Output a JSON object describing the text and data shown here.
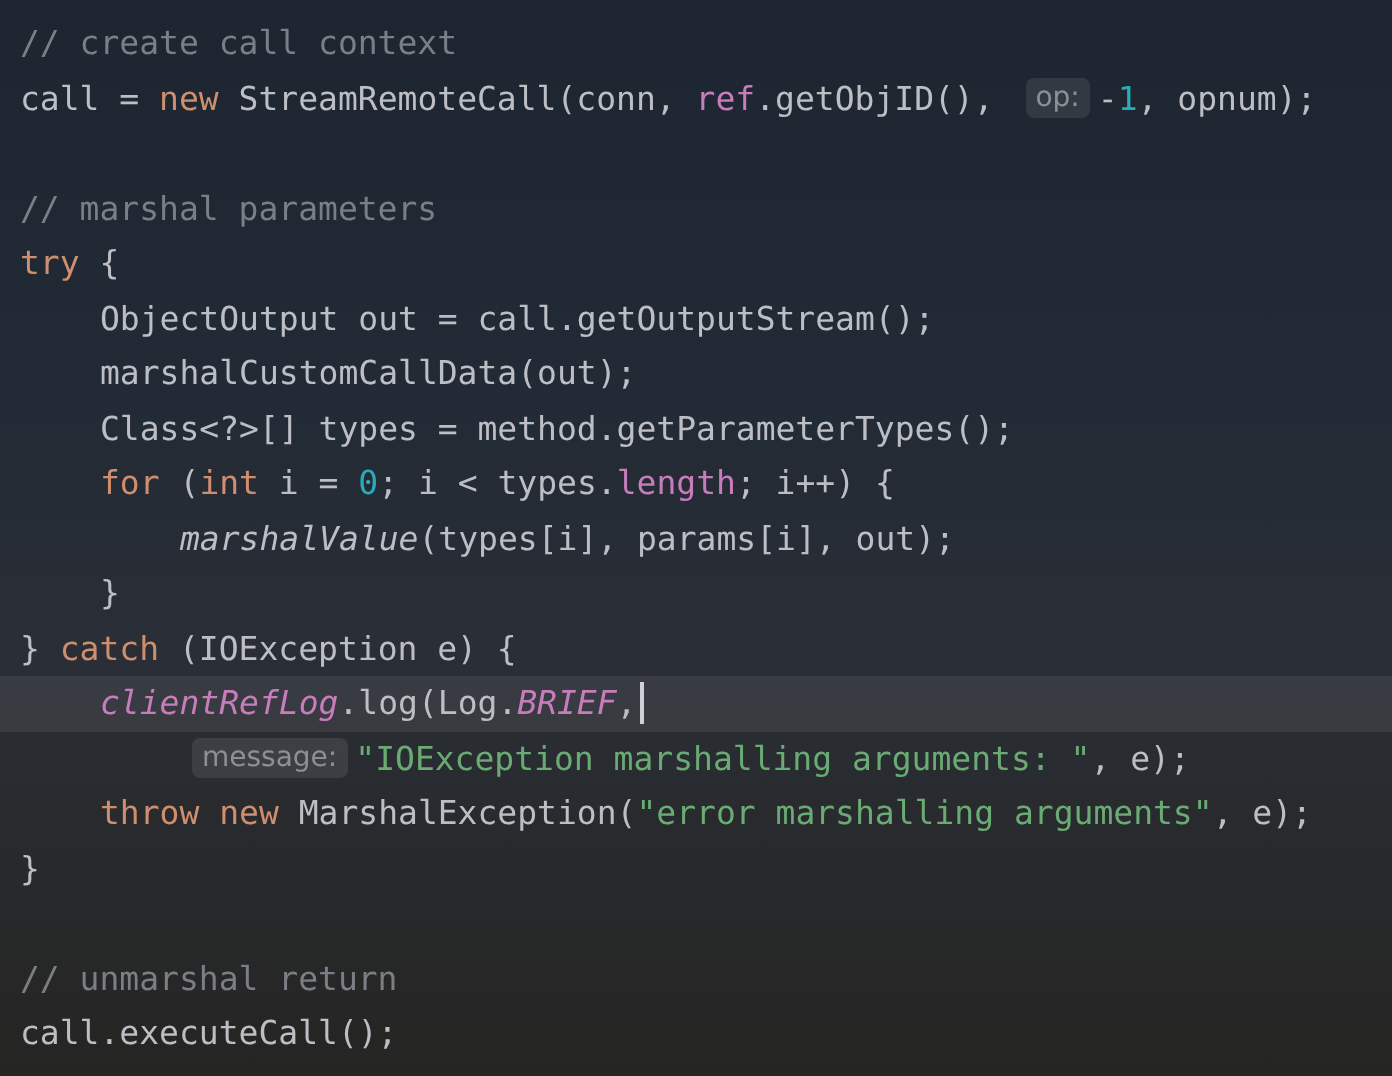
{
  "editor": {
    "lines": [
      {
        "current": false,
        "tokens": [
          {
            "kind": "comment",
            "text": "// create call context"
          }
        ]
      },
      {
        "current": false,
        "tokens": [
          {
            "kind": "plain",
            "text": "call = "
          },
          {
            "kind": "keyword",
            "text": "new"
          },
          {
            "kind": "plain",
            "text": " StreamRemoteCall(conn, "
          },
          {
            "kind": "field",
            "text": "ref"
          },
          {
            "kind": "plain",
            "text": ".getObjID(), "
          },
          {
            "kind": "hint",
            "text": "op:"
          },
          {
            "kind": "plain",
            "text": "-"
          },
          {
            "kind": "number",
            "text": "1"
          },
          {
            "kind": "plain",
            "text": ", opnum);"
          }
        ]
      },
      {
        "current": false
      },
      {
        "current": false,
        "tokens": [
          {
            "kind": "comment",
            "text": "// marshal parameters"
          }
        ]
      },
      {
        "current": false,
        "tokens": [
          {
            "kind": "keyword",
            "text": "try"
          },
          {
            "kind": "plain",
            "text": " {"
          }
        ],
        "children": [
          {
            "current": false,
            "tokens": [
              {
                "kind": "plain",
                "text": "ObjectOutput out = call.getOutputStream();"
              }
            ]
          },
          {
            "current": false,
            "tokens": [
              {
                "kind": "plain",
                "text": "marshalCustomCallData(out);"
              }
            ]
          },
          {
            "current": false,
            "tokens": [
              {
                "kind": "plain",
                "text": "Class<?>[] types = method.getParameterTypes();"
              }
            ]
          },
          {
            "current": false,
            "tokens": [
              {
                "kind": "keyword",
                "text": "for"
              },
              {
                "kind": "plain",
                "text": " ("
              },
              {
                "kind": "keyword",
                "text": "int"
              },
              {
                "kind": "plain",
                "text": " i = "
              },
              {
                "kind": "number",
                "text": "0"
              },
              {
                "kind": "plain",
                "text": "; i < types."
              },
              {
                "kind": "field",
                "text": "length"
              },
              {
                "kind": "plain",
                "text": "; i++) {"
              }
            ],
            "children": [
              {
                "current": false,
                "tokens": [
                  {
                    "kind": "method-italic",
                    "text": "marshalValue"
                  },
                  {
                    "kind": "plain",
                    "text": "(types[i], params[i], out);"
                  }
                ]
              }
            ]
          },
          {
            "current": false,
            "tokens": [
              {
                "kind": "plain",
                "text": "}"
              }
            ]
          }
        ]
      },
      {
        "current": false,
        "tokens": [
          {
            "kind": "plain",
            "text": "} "
          },
          {
            "kind": "keyword",
            "text": "catch"
          },
          {
            "kind": "plain",
            "text": " (IOException e) {"
          }
        ],
        "children": [
          {
            "current": true,
            "tokens": [
              {
                "kind": "static",
                "text": "clientRefLog"
              },
              {
                "kind": "plain",
                "text": ".log(Log."
              },
              {
                "kind": "static",
                "text": "BRIEF"
              },
              {
                "kind": "plain",
                "text": ","
              }
            ],
            "children": [
              {
                "current": false,
                "tokens": [
                  {
                    "kind": "hint",
                    "text": "message:"
                  },
                  {
                    "kind": "string",
                    "text": "\"IOException marshalling arguments: \""
                  },
                  {
                    "kind": "plain",
                    "text": ", e);"
                  }
                ]
              }
            ]
          },
          {
            "current": false,
            "tokens": [
              {
                "kind": "keyword",
                "text": "throw new"
              },
              {
                "kind": "plain",
                "text": " MarshalException("
              },
              {
                "kind": "string",
                "text": "\"error marshalling arguments\""
              },
              {
                "kind": "plain",
                "text": ", e);"
              }
            ]
          }
        ]
      },
      {
        "current": false,
        "tokens": [
          {
            "kind": "plain",
            "text": "}"
          }
        ]
      },
      {
        "current": false
      },
      {
        "current": false,
        "tokens": [
          {
            "kind": "comment",
            "text": "// unmarshal return"
          }
        ]
      },
      {
        "current": false,
        "tokens": [
          {
            "kind": "plain",
            "text": "call.executeCall();"
          }
        ]
      }
    ]
  }
}
